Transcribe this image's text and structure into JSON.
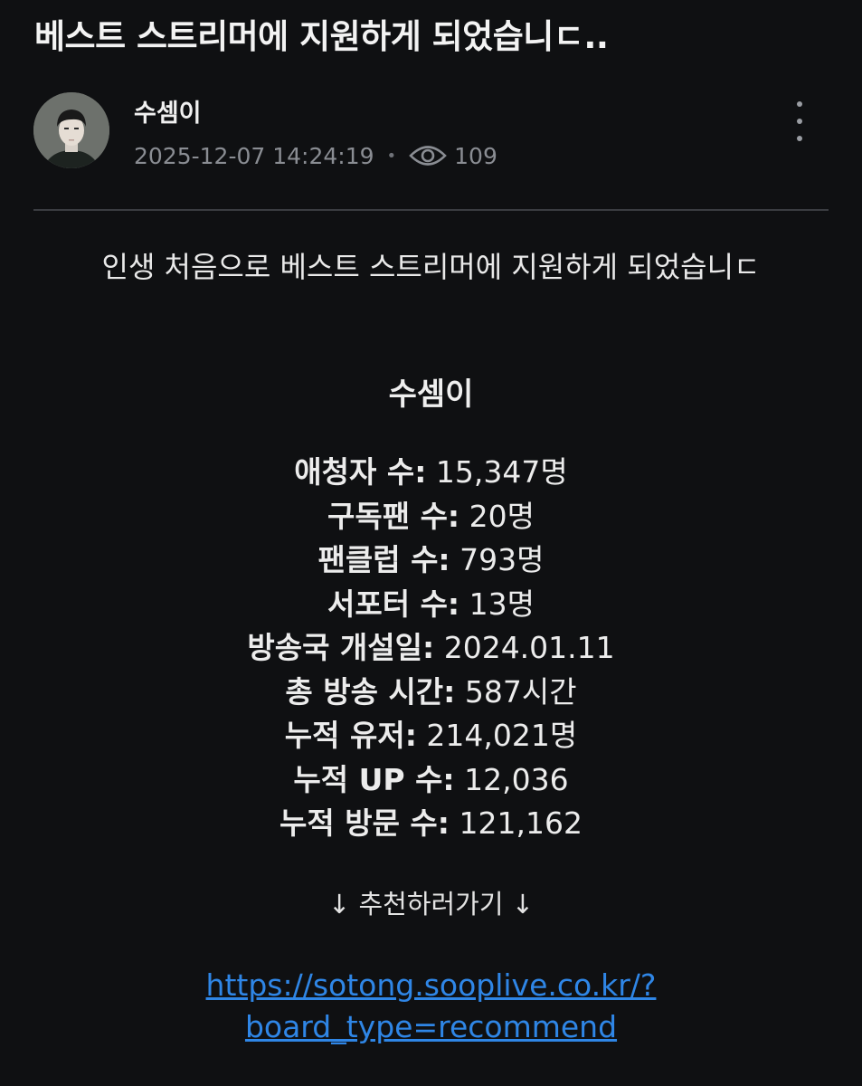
{
  "post": {
    "title": "베스트 스트리머에 지원하게 되었습니ㄷ..",
    "author": "수셈이",
    "timestamp": "2025-12-07 14:24:19",
    "separator": "•",
    "views": "109",
    "intro": "인생 처음으로 베스트 스트리머에 지원하게 되었습니ㄷ"
  },
  "icons": {
    "avatar": "avatar",
    "views": "eye-icon",
    "more": "more-vertical-icon"
  },
  "profile": {
    "name": "수셈이",
    "stats": [
      {
        "label": "애청자 수:",
        "value": "15,347명"
      },
      {
        "label": "구독팬 수:",
        "value": "20명"
      },
      {
        "label": "팬클럽 수:",
        "value": "793명"
      },
      {
        "label": "서포터 수:",
        "value": "13명"
      },
      {
        "label": "방송국 개설일:",
        "value": "2024.01.11"
      },
      {
        "label": "총 방송 시간:",
        "value": "587시간"
      },
      {
        "label": "누적 유저:",
        "value": "214,021명"
      },
      {
        "label": "누적 UP 수:",
        "value": "12,036"
      },
      {
        "label": "누적 방문 수:",
        "value": "121,162"
      }
    ],
    "cta": "↓ 추천하러가기 ↓",
    "link_line1": "https://sotong.sooplive.co.kr/?",
    "link_line2": "board_type=recommend"
  },
  "colors": {
    "background": "#0f1012",
    "link": "#2f86e6",
    "muted": "#8a8d93"
  }
}
